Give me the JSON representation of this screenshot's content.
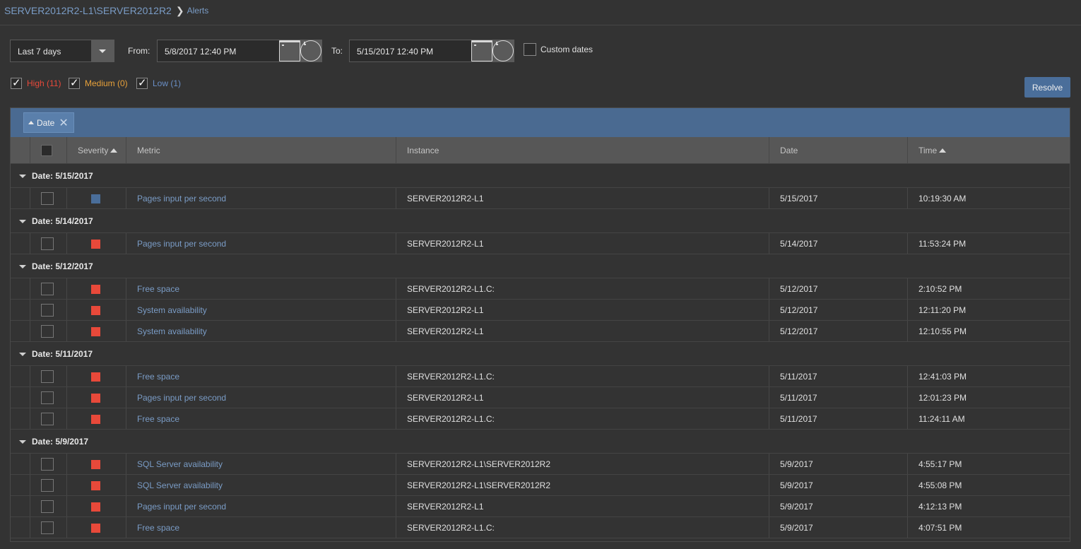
{
  "breadcrumb": {
    "path": "SERVER2012R2-L1\\SERVER2012R2",
    "separator": "❯",
    "current": "Alerts"
  },
  "filters": {
    "preset": "Last 7 days",
    "from_label": "From:",
    "from_value": "5/8/2017 12:40 PM",
    "to_label": "To:",
    "to_value": "5/15/2017 12:40 PM",
    "custom_dates_label": "Custom dates"
  },
  "severity": {
    "high": {
      "label": "High (11)",
      "color": "#e8493a",
      "checked": true
    },
    "medium": {
      "label": "Medium (0)",
      "color": "#e8a13a",
      "checked": true
    },
    "low": {
      "label": "Low (1)",
      "color": "#6a8fc6",
      "checked": true
    }
  },
  "toolbar": {
    "resolve_label": "Resolve"
  },
  "grouping": {
    "chip_label": "Date"
  },
  "columns": {
    "severity": "Severity",
    "metric": "Metric",
    "instance": "Instance",
    "date": "Date",
    "time": "Time"
  },
  "colors": {
    "high": "#e8493a",
    "low": "#4a6e9a",
    "accent": "#4a6a91"
  },
  "groups": [
    {
      "label": "Date: 5/15/2017",
      "rows": [
        {
          "severity": "low",
          "metric": "Pages input per second",
          "instance": "SERVER2012R2-L1",
          "date": "5/15/2017",
          "time": "10:19:30 AM"
        }
      ]
    },
    {
      "label": "Date: 5/14/2017",
      "rows": [
        {
          "severity": "high",
          "metric": "Pages input per second",
          "instance": "SERVER2012R2-L1",
          "date": "5/14/2017",
          "time": "11:53:24 PM"
        }
      ]
    },
    {
      "label": "Date: 5/12/2017",
      "rows": [
        {
          "severity": "high",
          "metric": "Free space",
          "instance": "SERVER2012R2-L1.C:",
          "date": "5/12/2017",
          "time": "2:10:52 PM"
        },
        {
          "severity": "high",
          "metric": "System availability",
          "instance": "SERVER2012R2-L1",
          "date": "5/12/2017",
          "time": "12:11:20 PM"
        },
        {
          "severity": "high",
          "metric": "System availability",
          "instance": "SERVER2012R2-L1",
          "date": "5/12/2017",
          "time": "12:10:55 PM"
        }
      ]
    },
    {
      "label": "Date: 5/11/2017",
      "rows": [
        {
          "severity": "high",
          "metric": "Free space",
          "instance": "SERVER2012R2-L1.C:",
          "date": "5/11/2017",
          "time": "12:41:03 PM"
        },
        {
          "severity": "high",
          "metric": "Pages input per second",
          "instance": "SERVER2012R2-L1",
          "date": "5/11/2017",
          "time": "12:01:23 PM"
        },
        {
          "severity": "high",
          "metric": "Free space",
          "instance": "SERVER2012R2-L1.C:",
          "date": "5/11/2017",
          "time": "11:24:11 AM"
        }
      ]
    },
    {
      "label": "Date: 5/9/2017",
      "rows": [
        {
          "severity": "high",
          "metric": "SQL Server availability",
          "instance": "SERVER2012R2-L1\\SERVER2012R2",
          "date": "5/9/2017",
          "time": "4:55:17 PM"
        },
        {
          "severity": "high",
          "metric": "SQL Server availability",
          "instance": "SERVER2012R2-L1\\SERVER2012R2",
          "date": "5/9/2017",
          "time": "4:55:08 PM"
        },
        {
          "severity": "high",
          "metric": "Pages input per second",
          "instance": "SERVER2012R2-L1",
          "date": "5/9/2017",
          "time": "4:12:13 PM"
        },
        {
          "severity": "high",
          "metric": "Free space",
          "instance": "SERVER2012R2-L1.C:",
          "date": "5/9/2017",
          "time": "4:07:51 PM"
        }
      ]
    }
  ]
}
